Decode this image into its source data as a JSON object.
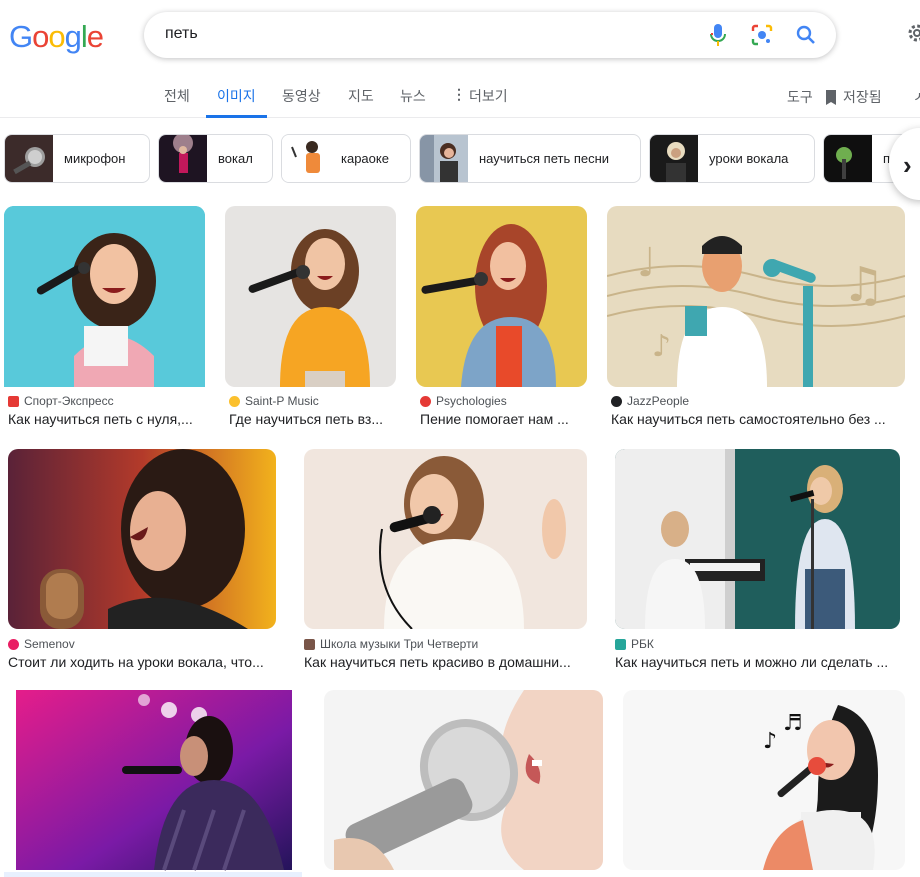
{
  "logo": {
    "letters": [
      "G",
      "o",
      "o",
      "g",
      "l",
      "e"
    ],
    "colors": [
      "#4285f4",
      "#ea4335",
      "#fbbc05",
      "#4285f4",
      "#34a853",
      "#ea4335"
    ]
  },
  "search": {
    "query": "петь"
  },
  "icons": {
    "mic": "microphone-icon",
    "lens": "google-lens-icon",
    "search": "search-icon",
    "settings": "gear-icon",
    "bookmark": "bookmark-icon",
    "more": "more-vert-icon",
    "next": "chevron-right-icon"
  },
  "tabs": [
    {
      "label": "전체"
    },
    {
      "label": "이미지"
    },
    {
      "label": "동영상"
    },
    {
      "label": "지도"
    },
    {
      "label": "뉴스"
    },
    {
      "label": "더보기"
    }
  ],
  "tools": {
    "label": "도구",
    "saved": "저장됨"
  },
  "chips": [
    {
      "label": "микрофон"
    },
    {
      "label": "вокал"
    },
    {
      "label": "караоке"
    },
    {
      "label": "научиться петь песни"
    },
    {
      "label": "уроки вокала"
    },
    {
      "label": "п"
    }
  ],
  "results": [
    {
      "source": "Спорт-Экспресс",
      "title": "Как научиться петь с нуля,..."
    },
    {
      "source": "Saint-P Music",
      "title": "Где научиться петь вз..."
    },
    {
      "source": "Psychologies",
      "title": "Пение помогает нам ..."
    },
    {
      "source": "JazzPeople",
      "title": "Как научиться петь самостоятельно без ..."
    },
    {
      "source": "Semenov",
      "title": "Стоит ли ходить на уроки вокала, что..."
    },
    {
      "source": "Школа музыки Три Четверти",
      "title": "Как научиться петь красиво в домашни..."
    },
    {
      "source": "РБК",
      "title": "Как научиться петь и можно ли сделать ..."
    },
    {
      "source": "",
      "title": ""
    },
    {
      "source": "",
      "title": ""
    },
    {
      "source": "",
      "title": ""
    }
  ],
  "colors": {
    "accent": "#1a73e8",
    "favicon_sport": "#e53935",
    "favicon_saintp": "#fbc02d",
    "favicon_psy": "#e53935",
    "favicon_jazz": "#202124",
    "favicon_semenov": "#e91e63",
    "favicon_school": "#795548",
    "favicon_rbc": "#26a69a"
  }
}
